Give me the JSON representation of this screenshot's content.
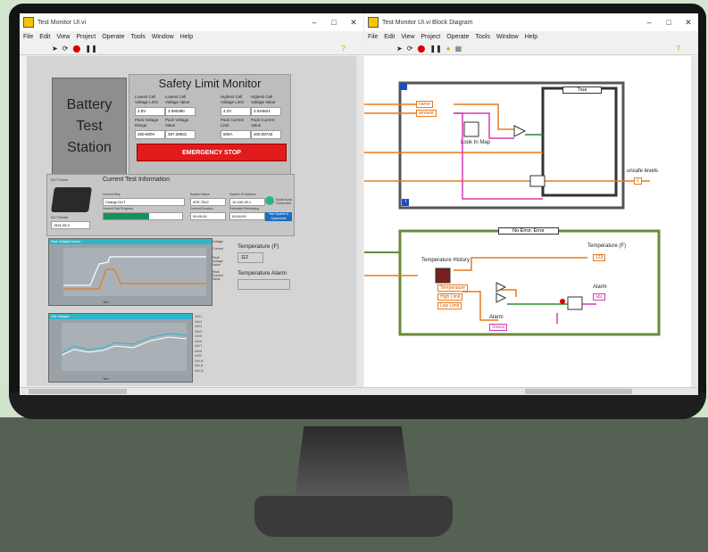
{
  "front_panel": {
    "title": "Test Monitor UI.vi",
    "menu": [
      "File",
      "Edit",
      "View",
      "Project",
      "Operate",
      "Tools",
      "Window",
      "Help"
    ],
    "battery_station": "Battery Test Station",
    "safety_title": "Safety Limit Monitor",
    "limits": [
      {
        "label": "Lowest Cell Voltage Limit",
        "value": "2.8V"
      },
      {
        "label": "Lowest Cell Voltage Value",
        "value": "3.090390"
      },
      {
        "label": "Highest Cell Voltage Limit",
        "value": "4.2V"
      },
      {
        "label": "Highest Cell Voltage Value",
        "value": "4.044821"
      },
      {
        "label": "Pack Voltage Range",
        "value": "250-600V"
      },
      {
        "label": "Pack Voltage Value",
        "value": "387.28931"
      },
      {
        "label": "Pack Current Limit",
        "value": "600A"
      },
      {
        "label": "Pack Current Value",
        "value": "400.08733"
      }
    ],
    "emergency_stop": "EMERGENCY STOP",
    "current_test_title": "Current Test Information",
    "dut_label": "DUT Picture",
    "serial_label": "DUT Serial#",
    "serial_value": "J931-35.0",
    "test_step_label": "Current Step",
    "test_step_value": "Charge DUT",
    "progress_label": "Current Test Progress",
    "progress": 0.58,
    "system_name_label": "System Name",
    "system_name_value": "ATE-7512",
    "duration_label": "Current Duration",
    "duration_value": "00:00:24",
    "ip_label": "System IP Address",
    "ip_value": "10.100.49.1",
    "remaining_label": "Estimated Remaining",
    "remaining_value": "00:00:00",
    "systemlink_label": "SystemLink Connected",
    "test_system_button": "Test System & Systemlink",
    "graph1_title": "Pack Voltage/Current",
    "graph2_title": "Cell Voltages",
    "temperature_label": "Temperature (F)",
    "temperature_value": "112",
    "temperature_alarm_label": "Temperature Alarm",
    "voltage_label": "Voltage",
    "current_label": "Current",
    "pack_voltage_label": "Pack Voltage Value",
    "pack_current_label": "Pack Current Value",
    "cells": [
      "Cell 1",
      "Cell 2",
      "Cell 3",
      "Cell 4",
      "Cell 5",
      "Cell 6",
      "Cell 7",
      "Cell 8",
      "Cell 9",
      "Cell 10",
      "Cell 11",
      "Cell 12"
    ],
    "time_label": "Time"
  },
  "block_diagram": {
    "title": "Test Monitor UI.vi Block Diagram",
    "menu": [
      "File",
      "Edit",
      "View",
      "Project",
      "Operate",
      "Tools",
      "Window",
      "Help"
    ],
    "case_true": "True",
    "name_term": "name",
    "amount_term": "amount",
    "look_in_map": "Look In Map",
    "unsafe_levels": "unsafe levels",
    "error_case": "No Error, Error",
    "temperature_history": "Temperature History",
    "temperature_out": "Temperature (F)",
    "temperature_in": "Temperature",
    "high_limit": "High Limit",
    "low_limit": "Low Limit",
    "alarm_label": "Alarm",
    "alarm_out": "Alarm",
    "status": "Status",
    "iter": "i"
  },
  "colors": {
    "accent": "#30b4c8",
    "stop": "#e11b1b",
    "progress": "#1b8f5a",
    "wire_orange": "#e67a1e",
    "wire_pink": "#d43cb4",
    "wire_green": "#2c8a2c"
  }
}
